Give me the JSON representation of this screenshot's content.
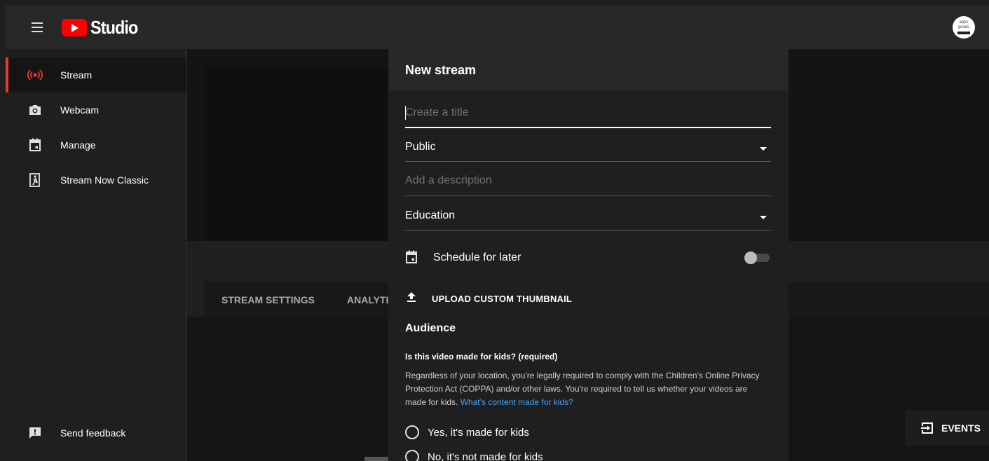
{
  "topbar": {
    "logo_text": "Studio",
    "avatar_text_1": "apps",
    "avatar_text_2": "goods"
  },
  "sidebar": {
    "items": [
      {
        "label": "Stream",
        "icon": "live-broadcast-icon",
        "active": true
      },
      {
        "label": "Webcam",
        "icon": "camera-icon"
      },
      {
        "label": "Manage",
        "icon": "calendar-icon"
      },
      {
        "label": "Stream Now Classic",
        "icon": "stream-now-classic-icon"
      }
    ],
    "feedback_label": "Send feedback"
  },
  "main": {
    "tabs": [
      {
        "label": "STREAM SETTINGS"
      },
      {
        "label": "ANALYTICS"
      }
    ],
    "events_label": "EVENTS"
  },
  "modal": {
    "title": "New stream",
    "title_placeholder": "Create a title",
    "visibility_value": "Public",
    "description_placeholder": "Add a description",
    "category_value": "Education",
    "schedule_label": "Schedule for later",
    "schedule_enabled": false,
    "upload_label": "UPLOAD CUSTOM THUMBNAIL",
    "audience_title": "Audience",
    "kids_question": "Is this video made for kids? (required)",
    "kids_description": "Regardless of your location, you're legally required to comply with the Children's Online Privacy Protection Act (COPPA) and/or other laws. You're required to tell us whether your videos are made for kids.",
    "kids_link": "What's content made for kids?",
    "radio_yes": "Yes, it's made for kids",
    "radio_no": "No, it's not made for kids"
  },
  "colors": {
    "accent_red": "#ff0000",
    "active_indicator": "#e53935",
    "link_blue": "#3ea6ff"
  }
}
